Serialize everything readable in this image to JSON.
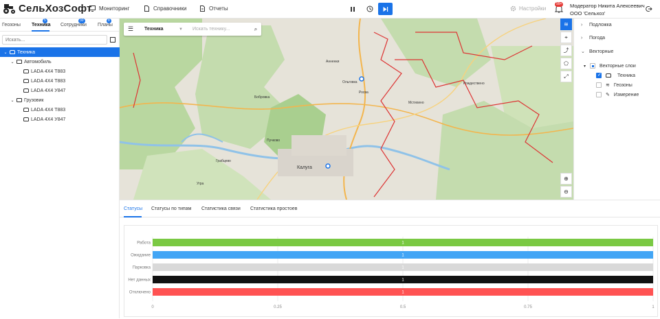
{
  "app": {
    "logo_text": "СельХозСофт",
    "menu": [
      {
        "label": "Мониторинг",
        "icon": "monitor-icon"
      },
      {
        "label": "Справочники",
        "icon": "document-icon"
      },
      {
        "label": "Отчеты",
        "icon": "report-icon"
      }
    ],
    "controls": {
      "pause": "pause-icon",
      "history": "history-icon",
      "live": "play-icon"
    },
    "settings_label": "Настройки",
    "notifications_badge": "99+",
    "user_name": "Модератор Никита Алексеевич",
    "org_name": "ООО 'Сельхоз'"
  },
  "left": {
    "tabs": [
      {
        "label": "Геозоны",
        "badge": ""
      },
      {
        "label": "Техника",
        "badge": "5"
      },
      {
        "label": "Сотрудники",
        "badge": "30"
      },
      {
        "label": "Планы",
        "badge": "8"
      }
    ],
    "search_placeholder": "Искать...",
    "tree": [
      {
        "label": "Техника",
        "level": 0,
        "kind": "root",
        "selected": true
      },
      {
        "label": "Автомобиль",
        "level": 1,
        "kind": "folder"
      },
      {
        "label": "LADA 4X4 Т883",
        "level": 2,
        "kind": "vehicle"
      },
      {
        "label": "LADA 4X4 Т883",
        "level": 2,
        "kind": "vehicle"
      },
      {
        "label": "LADA 4X4 У847",
        "level": 2,
        "kind": "vehicle"
      },
      {
        "label": "Грузовик",
        "level": 1,
        "kind": "folder"
      },
      {
        "label": "LADA 4X4 Т883",
        "level": 2,
        "kind": "vehicle"
      },
      {
        "label": "LADA 4X4 У847",
        "level": 2,
        "kind": "vehicle"
      }
    ]
  },
  "map": {
    "filter_value": "Техника",
    "search_placeholder": "Искать технику...",
    "labels": [
      "Калуга",
      "Ольговка",
      "Росва",
      "Бобровка",
      "Пучково",
      "Угра",
      "Грабцево",
      "Рождествено",
      "Мстихино",
      "Анненки"
    ],
    "tools": [
      "layers-icon",
      "locate-icon",
      "route-icon",
      "polygon-icon",
      "fullscreen-icon"
    ],
    "zoom": [
      "zoom-in-icon",
      "zoom-out-icon"
    ]
  },
  "right": {
    "items": [
      {
        "label": "Подложка",
        "expanded": false
      },
      {
        "label": "Погода",
        "expanded": false
      },
      {
        "label": "Векторные",
        "expanded": true
      }
    ],
    "vector_group": "Векторные слои",
    "layers": [
      {
        "label": "Техника",
        "checked": true,
        "icon": "car-icon"
      },
      {
        "label": "Геозоны",
        "checked": false,
        "icon": "layers-icon"
      },
      {
        "label": "Измерение",
        "checked": false,
        "icon": "ruler-icon"
      }
    ]
  },
  "bottom": {
    "tabs": [
      "Статусы",
      "Статусы по типам",
      "Статистика связи",
      "Статистика простоев"
    ],
    "active_tab": 0
  },
  "chart_data": {
    "type": "bar",
    "orientation": "horizontal",
    "categories": [
      "Работа",
      "Ожидание",
      "Парковка",
      "Нет данных",
      "Отключено"
    ],
    "values": [
      1,
      1,
      1,
      1,
      1
    ],
    "colors": [
      "#7ac943",
      "#42a5f5",
      "#d9d9d9",
      "#111111",
      "#ff5252"
    ],
    "data_labels": [
      "1",
      "1",
      "1",
      "1",
      "1"
    ],
    "xlim": [
      0,
      1
    ],
    "xticks": [
      "0",
      "0.25",
      "0.5",
      "0.75",
      "1"
    ],
    "grid": true,
    "title": "",
    "xlabel": "",
    "ylabel": ""
  }
}
